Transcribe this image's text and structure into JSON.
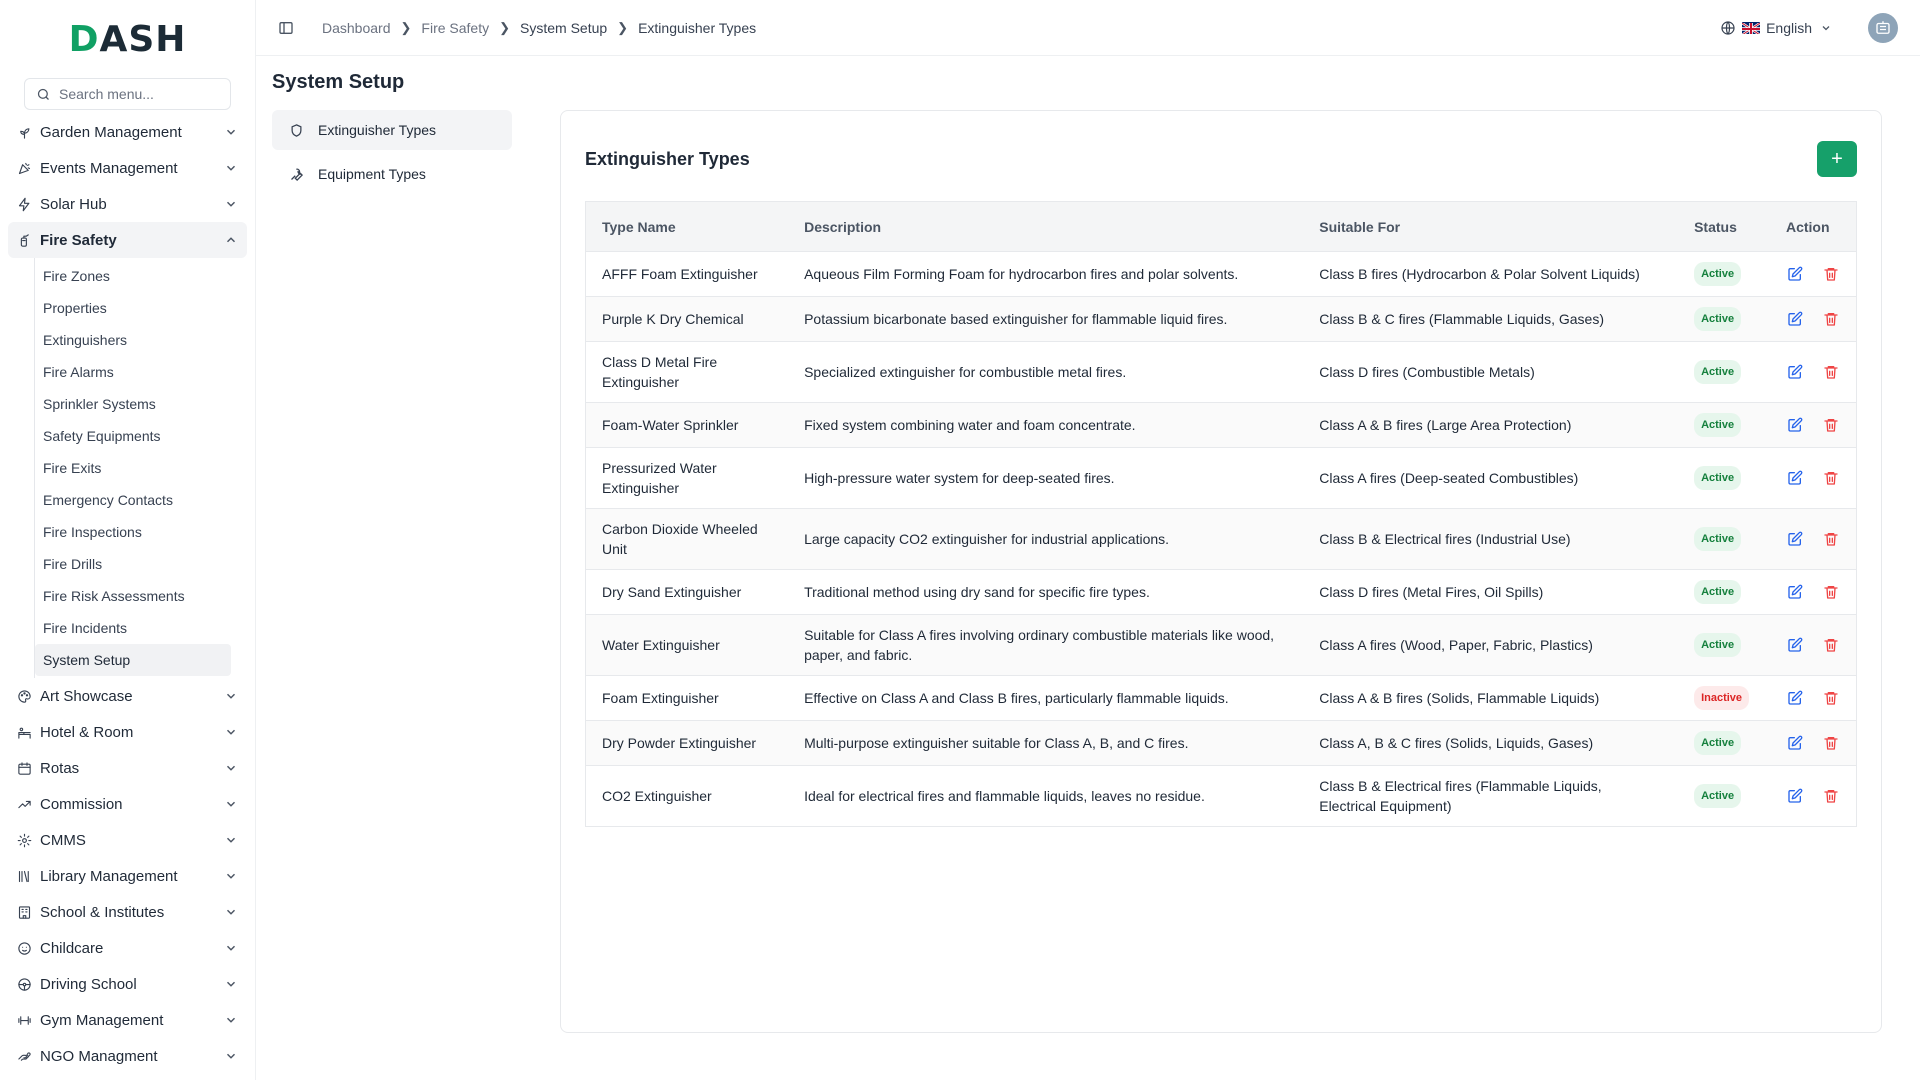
{
  "brand": {
    "logo_d": "D",
    "logo_rest": "ASH",
    "accent": "#16a06a"
  },
  "search": {
    "placeholder": "Search menu..."
  },
  "sidebar": {
    "items_top": [
      {
        "label": "Garden Management",
        "icon": "plant-icon"
      },
      {
        "label": "Events Management",
        "icon": "party-icon"
      },
      {
        "label": "Solar Hub",
        "icon": "bolt-icon"
      }
    ],
    "active": {
      "label": "Fire Safety",
      "icon": "extinguisher-icon"
    },
    "sub_items": [
      "Fire Zones",
      "Properties",
      "Extinguishers",
      "Fire Alarms",
      "Sprinkler Systems",
      "Safety Equipments",
      "Fire Exits",
      "Emergency Contacts",
      "Fire Inspections",
      "Fire Drills",
      "Fire Risk Assessments",
      "Fire Incidents",
      "System Setup"
    ],
    "active_sub": "System Setup",
    "items_bottom": [
      {
        "label": "Art Showcase",
        "icon": "palette-icon"
      },
      {
        "label": "Hotel & Room",
        "icon": "hotel-icon"
      },
      {
        "label": "Rotas",
        "icon": "calendar-icon"
      },
      {
        "label": "Commission",
        "icon": "trend-icon"
      },
      {
        "label": "CMMS",
        "icon": "cog-icon"
      },
      {
        "label": "Library Management",
        "icon": "library-icon"
      },
      {
        "label": "School & Institutes",
        "icon": "school-icon"
      },
      {
        "label": "Childcare",
        "icon": "baby-icon"
      },
      {
        "label": "Driving School",
        "icon": "steering-icon"
      },
      {
        "label": "Gym Management",
        "icon": "dumbbell-icon"
      },
      {
        "label": "NGO Managment",
        "icon": "hand-heart-icon"
      }
    ]
  },
  "breadcrumb": [
    "Dashboard",
    "Fire Safety",
    "System Setup",
    "Extinguisher Types"
  ],
  "language": "English",
  "page": {
    "title": "System Setup"
  },
  "submenu": [
    {
      "label": "Extinguisher Types",
      "icon": "shield-icon"
    },
    {
      "label": "Equipment Types",
      "icon": "wrench-icon"
    }
  ],
  "card": {
    "title": "Extinguisher Types",
    "add_label": "+"
  },
  "table": {
    "headers": [
      "Type Name",
      "Description",
      "Suitable For",
      "Status",
      "Action"
    ],
    "rows": [
      {
        "name": "AFFF Foam Extinguisher",
        "desc": "Aqueous Film Forming Foam for hydrocarbon fires and polar solvents.",
        "suit": "Class B fires (Hydrocarbon & Polar Solvent Liquids)",
        "status": "Active"
      },
      {
        "name": "Purple K Dry Chemical",
        "desc": "Potassium bicarbonate based extinguisher for flammable liquid fires.",
        "suit": "Class B & C fires (Flammable Liquids, Gases)",
        "status": "Active"
      },
      {
        "name": "Class D Metal Fire Extinguisher",
        "desc": "Specialized extinguisher for combustible metal fires.",
        "suit": "Class D fires (Combustible Metals)",
        "status": "Active"
      },
      {
        "name": "Foam-Water Sprinkler",
        "desc": "Fixed system combining water and foam concentrate.",
        "suit": "Class A & B fires (Large Area Protection)",
        "status": "Active"
      },
      {
        "name": "Pressurized Water Extinguisher",
        "desc": "High-pressure water system for deep-seated fires.",
        "suit": "Class A fires (Deep-seated Combustibles)",
        "status": "Active"
      },
      {
        "name": "Carbon Dioxide Wheeled Unit",
        "desc": "Large capacity CO2 extinguisher for industrial applications.",
        "suit": "Class B & Electrical fires (Industrial Use)",
        "status": "Active"
      },
      {
        "name": "Dry Sand Extinguisher",
        "desc": "Traditional method using dry sand for specific fire types.",
        "suit": "Class D fires (Metal Fires, Oil Spills)",
        "status": "Active"
      },
      {
        "name": "Water Extinguisher",
        "desc": "Suitable for Class A fires involving ordinary combustible materials like wood, paper, and fabric.",
        "suit": "Class A fires (Wood, Paper, Fabric, Plastics)",
        "status": "Active"
      },
      {
        "name": "Foam Extinguisher",
        "desc": "Effective on Class A and Class B fires, particularly flammable liquids.",
        "suit": "Class A & B fires (Solids, Flammable Liquids)",
        "status": "Inactive"
      },
      {
        "name": "Dry Powder Extinguisher",
        "desc": "Multi-purpose extinguisher suitable for Class A, B, and C fires.",
        "suit": "Class A, B & C fires (Solids, Liquids, Gases)",
        "status": "Active"
      },
      {
        "name": "CO2 Extinguisher",
        "desc": "Ideal for electrical fires and flammable liquids, leaves no residue.",
        "suit": "Class B & Electrical fires (Flammable Liquids, Electrical Equipment)",
        "status": "Active"
      }
    ]
  },
  "colors": {
    "edit": "#2563eb",
    "delete": "#ef4444",
    "active_bg": "#e6f6ec",
    "inactive_bg": "#fdeaea"
  }
}
